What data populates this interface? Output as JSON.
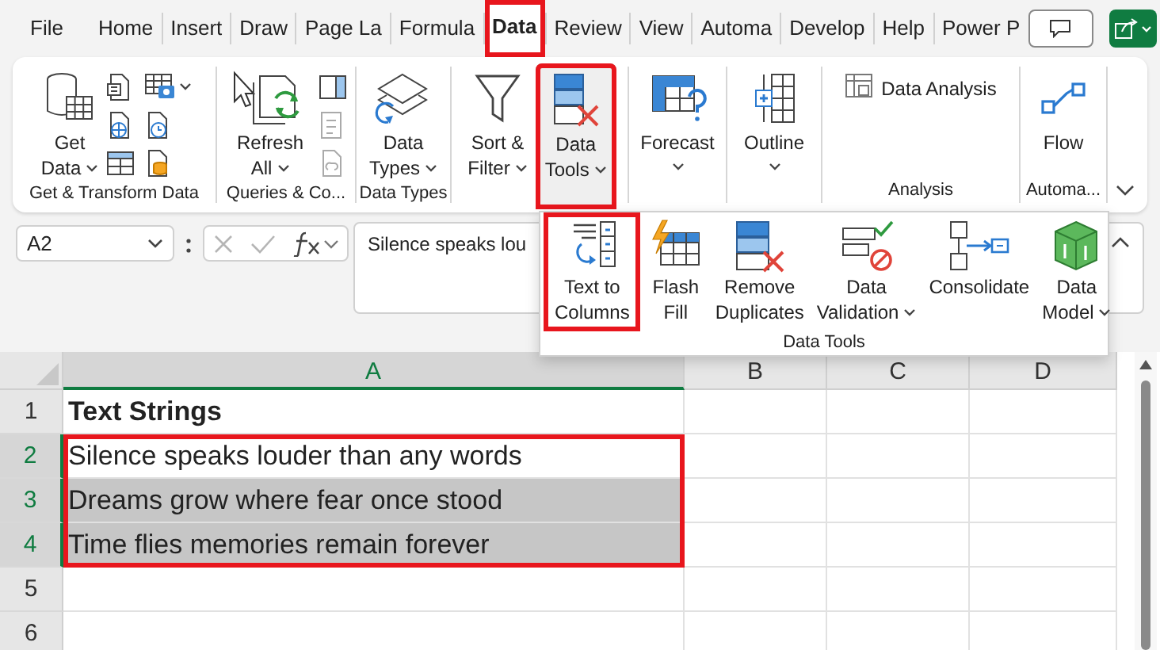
{
  "menu_tabs": [
    {
      "label": "File",
      "selected": false,
      "highlighted": false
    },
    {
      "label": "Home",
      "selected": false,
      "highlighted": false
    },
    {
      "label": "Insert",
      "selected": false,
      "highlighted": false
    },
    {
      "label": "Draw",
      "selected": false,
      "highlighted": false
    },
    {
      "label": "Page La",
      "selected": false,
      "highlighted": false
    },
    {
      "label": "Formula",
      "selected": false,
      "highlighted": false
    },
    {
      "label": "Data",
      "selected": true,
      "highlighted": true
    },
    {
      "label": "Review",
      "selected": false,
      "highlighted": false
    },
    {
      "label": "View",
      "selected": false,
      "highlighted": false
    },
    {
      "label": "Automa",
      "selected": false,
      "highlighted": false
    },
    {
      "label": "Develop",
      "selected": false,
      "highlighted": false
    },
    {
      "label": "Help",
      "selected": false,
      "highlighted": false
    },
    {
      "label": "Power P",
      "selected": false,
      "highlighted": false
    }
  ],
  "ribbon": {
    "groups": [
      {
        "label": "Get & Transform Data",
        "buttons": [
          {
            "kind": "large",
            "lines": [
              "Get",
              "Data"
            ],
            "dropdown": true,
            "highlighted": false,
            "expanded": false
          },
          {
            "kind": "icon_stack"
          }
        ]
      },
      {
        "label": "Queries & Co...",
        "buttons": [
          {
            "kind": "large",
            "lines": [
              "Refresh",
              "All"
            ],
            "dropdown": true,
            "highlighted": false,
            "expanded": false
          },
          {
            "kind": "icon_stack"
          }
        ]
      },
      {
        "label": "Data Types",
        "buttons": [
          {
            "kind": "large",
            "lines": [
              "Data",
              "Types"
            ],
            "dropdown": true,
            "highlighted": false,
            "expanded": false
          }
        ]
      },
      {
        "buttons": [
          {
            "kind": "large",
            "lines": [
              "Sort &",
              "Filter"
            ],
            "dropdown": true,
            "highlighted": false,
            "expanded": false
          },
          {
            "kind": "large",
            "lines": [
              "Data",
              "Tools"
            ],
            "dropdown": true,
            "highlighted": true,
            "expanded": true
          }
        ]
      },
      {
        "buttons": [
          {
            "kind": "large",
            "lines": [
              "Forecast"
            ],
            "dropdown": true,
            "highlighted": false,
            "expanded": false
          }
        ]
      },
      {
        "buttons": [
          {
            "kind": "large",
            "lines": [
              "Outline"
            ],
            "dropdown": true,
            "highlighted": false,
            "expanded": false
          }
        ]
      },
      {
        "label": "Analysis",
        "buttons": [
          {
            "kind": "small",
            "lines": [
              "Data Analysis"
            ]
          }
        ]
      },
      {
        "label": "Automa...",
        "buttons": [
          {
            "kind": "large",
            "lines": [
              "Flow"
            ],
            "dropdown": false,
            "highlighted": false,
            "expanded": false
          }
        ]
      }
    ]
  },
  "data_tools_popup": {
    "label": "Data Tools",
    "buttons": [
      {
        "lines": [
          "Text to",
          "Columns"
        ],
        "dropdown": false,
        "highlighted": true
      },
      {
        "lines": [
          "Flash",
          "Fill"
        ],
        "dropdown": false,
        "highlighted": false
      },
      {
        "lines": [
          "Remove",
          "Duplicates"
        ],
        "dropdown": false,
        "highlighted": false
      },
      {
        "lines": [
          "Data",
          "Validation"
        ],
        "dropdown": true,
        "highlighted": false
      },
      {
        "lines": [
          "Consolidate"
        ],
        "dropdown": false,
        "highlighted": false
      },
      {
        "lines": [
          "Data",
          "Model"
        ],
        "dropdown": true,
        "highlighted": false
      }
    ]
  },
  "formula_bar": {
    "name_box": "A2",
    "formula": "Silence speaks lou"
  },
  "sheet": {
    "selection_outlined": true,
    "columns": [
      {
        "label": "A",
        "selected": true
      },
      {
        "label": "B",
        "selected": false
      },
      {
        "label": "C",
        "selected": false
      },
      {
        "label": "D",
        "selected": false
      }
    ],
    "rows": [
      {
        "number": "1",
        "selected": false,
        "cells": [
          {
            "text": "Text Strings",
            "bold": true,
            "selected": false,
            "active": false
          }
        ]
      },
      {
        "number": "2",
        "selected": true,
        "cells": [
          {
            "text": "Silence speaks louder than any words",
            "bold": false,
            "selected": true,
            "active": true
          }
        ]
      },
      {
        "number": "3",
        "selected": true,
        "cells": [
          {
            "text": "Dreams grow where fear once stood",
            "bold": false,
            "selected": true,
            "active": false
          }
        ]
      },
      {
        "number": "4",
        "selected": true,
        "cells": [
          {
            "text": "Time flies memories remain forever",
            "bold": false,
            "selected": true,
            "active": false
          }
        ]
      },
      {
        "number": "5",
        "selected": false
      },
      {
        "number": "6",
        "selected": false
      }
    ]
  }
}
